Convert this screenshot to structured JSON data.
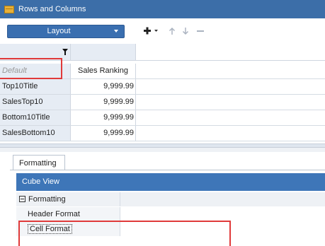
{
  "window": {
    "title": "Rows and Columns"
  },
  "toolbar": {
    "layout_label": "Layout",
    "buttons": [
      "add-icon",
      "move-up-icon",
      "move-down-icon",
      "remove-icon"
    ]
  },
  "grid": {
    "column_header": "Sales Ranking",
    "rows": [
      {
        "label": "Default",
        "value": ""
      },
      {
        "label": "Top10Title",
        "value": "9,999.99"
      },
      {
        "label": "SalesTop10",
        "value": "9,999.99"
      },
      {
        "label": "Bottom10Title",
        "value": "9,999.99"
      },
      {
        "label": "SalesBottom10",
        "value": "9,999.99"
      }
    ]
  },
  "lower_panel": {
    "tab_label": "Formatting",
    "section_title": "Cube View",
    "category": "Formatting",
    "items": [
      "Header Format",
      "Cell Format"
    ]
  },
  "colors": {
    "titlebar": "#3c6ea8",
    "accent": "#3e76b8",
    "highlight": "#e03a3a"
  }
}
